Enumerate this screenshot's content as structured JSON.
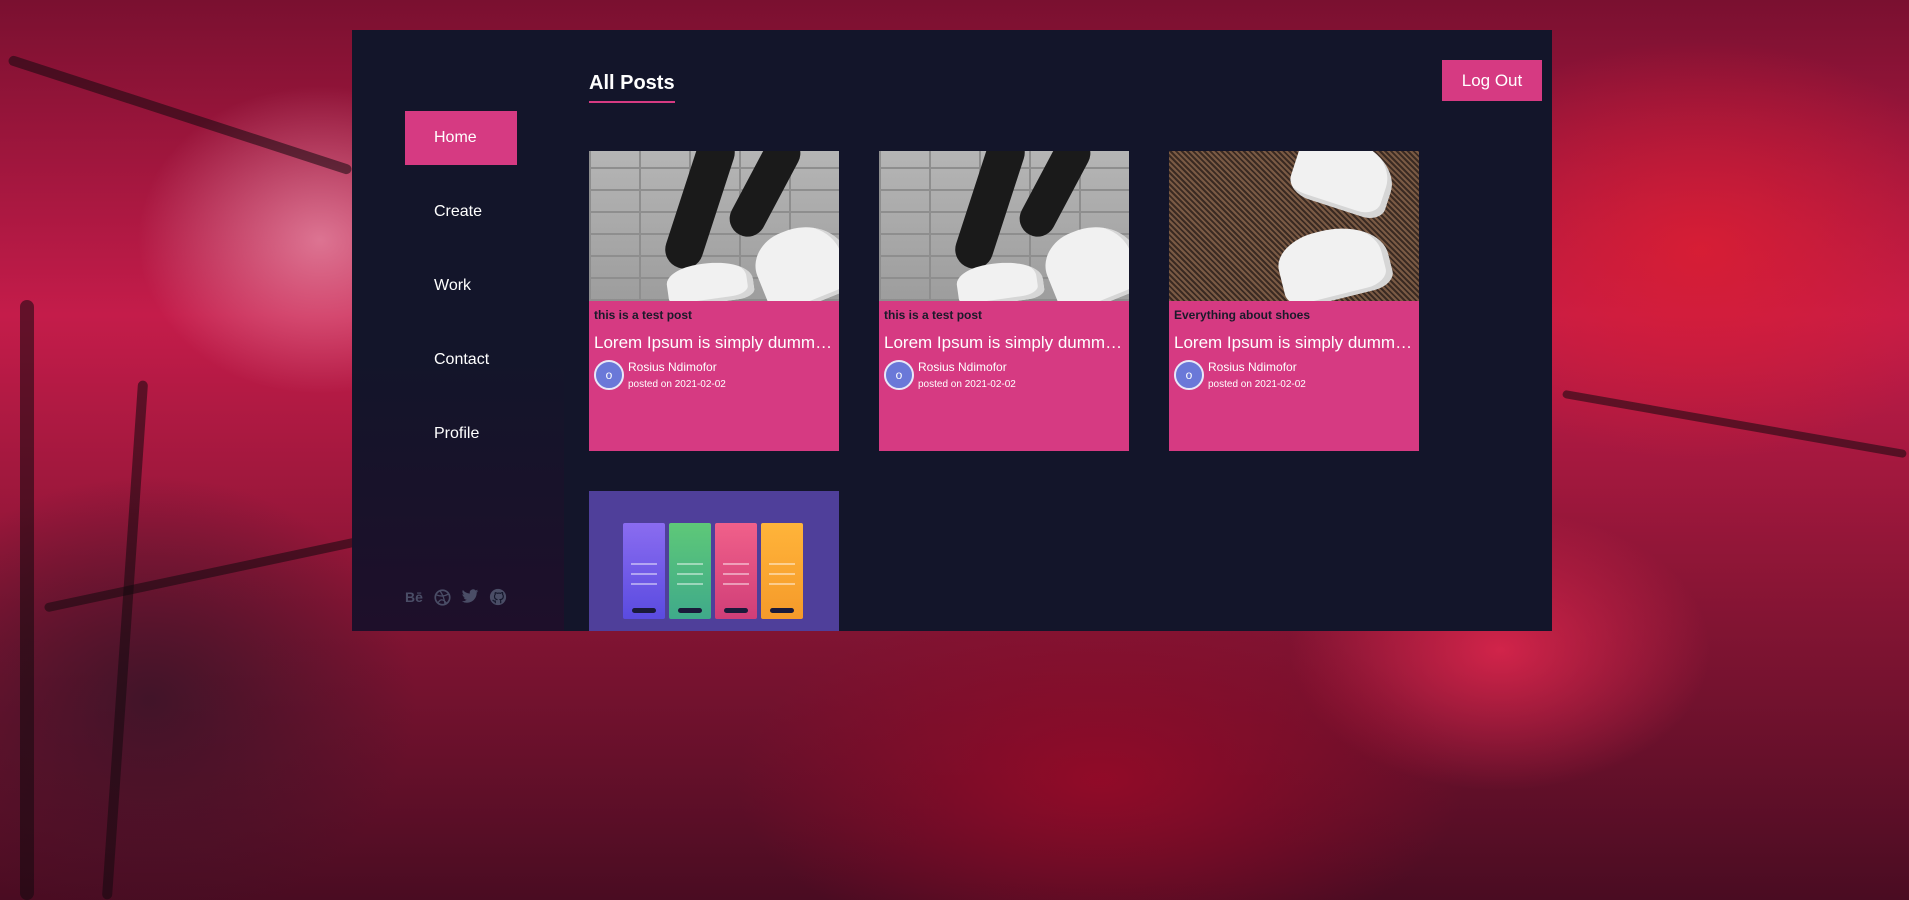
{
  "sidebar": {
    "items": [
      {
        "label": "Home",
        "active": true
      },
      {
        "label": "Create",
        "active": false
      },
      {
        "label": "Work",
        "active": false
      },
      {
        "label": "Contact",
        "active": false
      },
      {
        "label": "Profile",
        "active": false
      }
    ],
    "social": [
      {
        "icon": "behance-icon",
        "glyph": "Bē"
      },
      {
        "icon": "dribbble-icon",
        "glyph": "◎"
      },
      {
        "icon": "twitter-icon",
        "glyph": "🐦"
      },
      {
        "icon": "github-icon",
        "glyph": "●"
      }
    ]
  },
  "header": {
    "title": "All Posts",
    "logout_label": "Log Out"
  },
  "posts": [
    {
      "category": "this is a test post",
      "title": "Lorem Ipsum is simply dummy text of the printing",
      "author": "Rosius Ndimofor",
      "date": "posted on 2021-02-02",
      "image": "sneakers-wall"
    },
    {
      "category": "this is a test post",
      "title": "Lorem Ipsum is simply dummy text of the printing",
      "author": "Rosius Ndimofor",
      "date": "posted on 2021-02-02",
      "image": "sneakers-wall"
    },
    {
      "category": "Everything about shoes",
      "title": "Lorem Ipsum is simply dummy text of the printing",
      "author": "Rosius Ndimofor",
      "date": "posted on 2021-02-02",
      "image": "sneakers-carpet"
    },
    {
      "category": "",
      "title": "",
      "author": "",
      "date": "",
      "image": "pricing-table"
    }
  ],
  "colors": {
    "accent": "#d63a82",
    "panel": "#13152a",
    "text": "#ffffff"
  }
}
